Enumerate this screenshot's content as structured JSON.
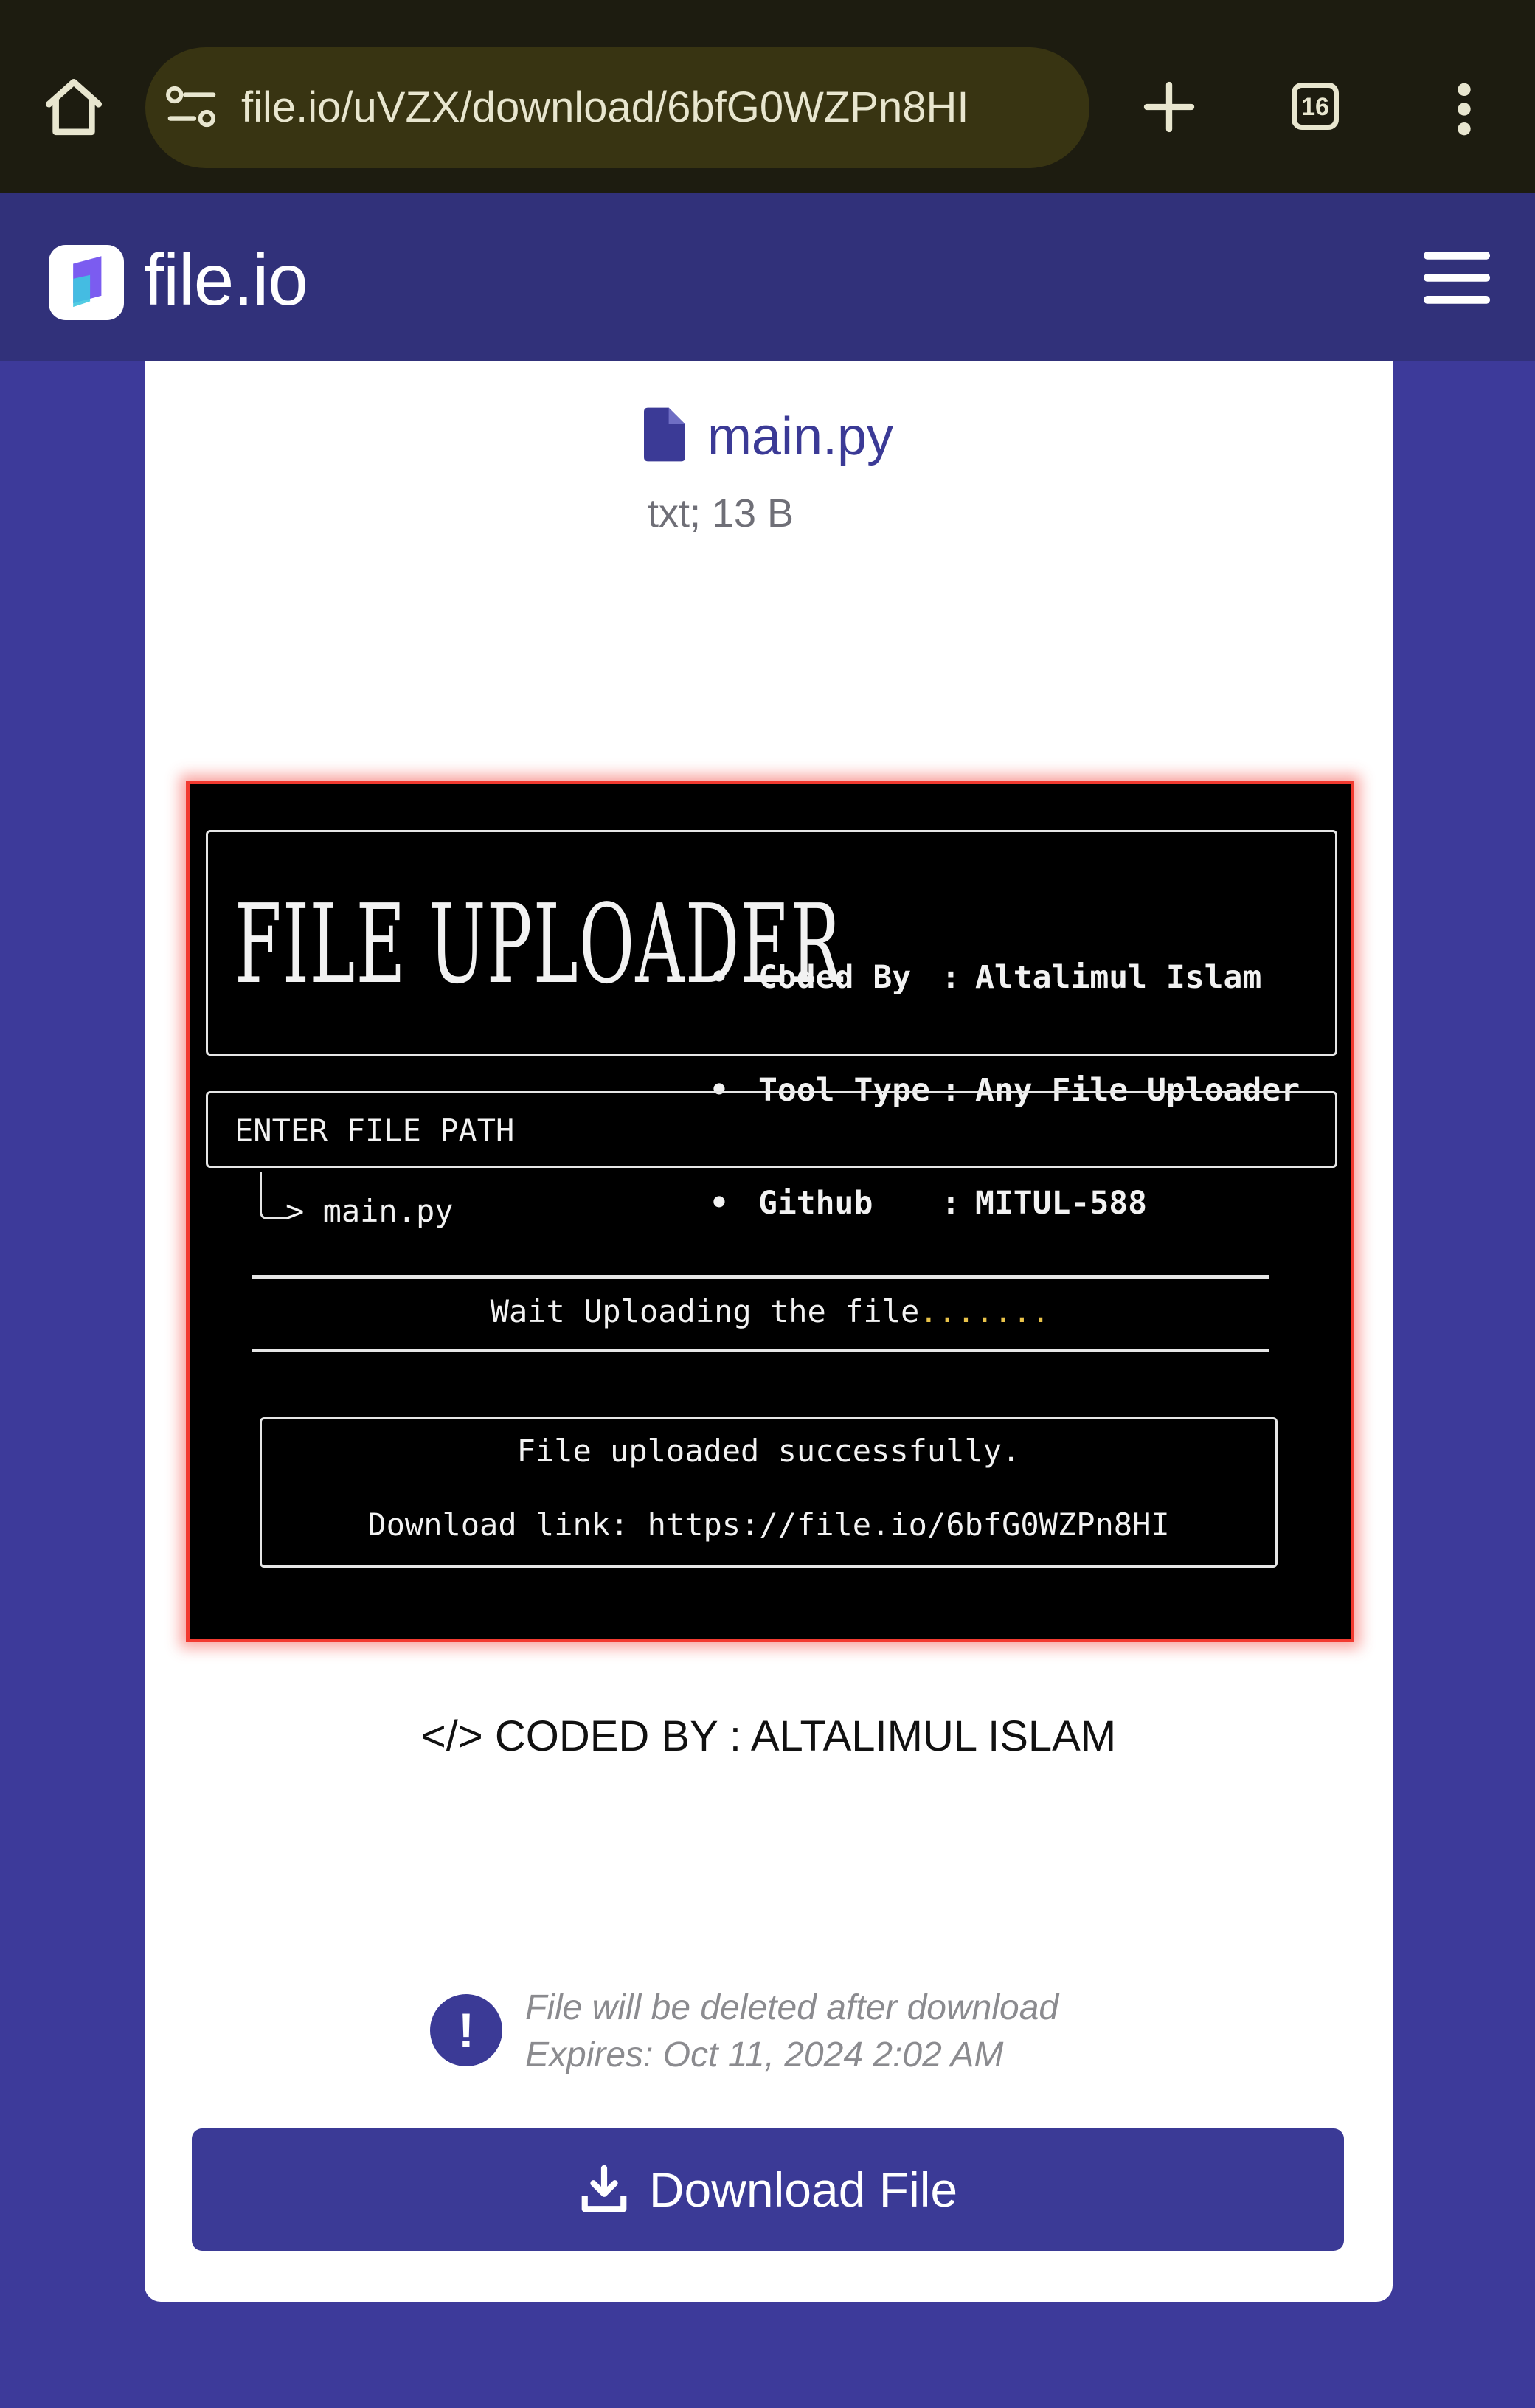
{
  "browser": {
    "url": "file.io/uVZX/download/6bfG0WZPn8HI",
    "tab_count": "16"
  },
  "site": {
    "logo_text": "file.io"
  },
  "file": {
    "name": "main.py",
    "meta": "txt; 13 B"
  },
  "terminal": {
    "banner_title": "FILE UPLOADER",
    "info": [
      {
        "key": "Coded By",
        "value": "Altalimul Islam"
      },
      {
        "key": "Tool Type",
        "value": "Any File Uploader"
      },
      {
        "key": "Github",
        "value": "MITUL-588"
      }
    ],
    "bullet": "•",
    "colon": ":",
    "path_prompt": "ENTER FILE PATH",
    "path_value": "> main.py",
    "wait_text": "Wait Uploading the file",
    "wait_dots": ".......",
    "success_text": "File uploaded successfully.",
    "download_link_text": "Download link: https://file.io/6bfG0WZPn8HI"
  },
  "coded_by": "</> CODED BY : ALTALIMUL ISLAM",
  "notice": {
    "line1": "File will be deleted after download",
    "line2": "Expires: Oct 11, 2024 2:02 AM",
    "icon_text": "!"
  },
  "download_button": {
    "label": "Download File"
  },
  "colors": {
    "brand": "#3b3a96",
    "page_bg": "#3d3a9a",
    "header_bg": "#31317a",
    "terminal_border": "#f23a30"
  }
}
